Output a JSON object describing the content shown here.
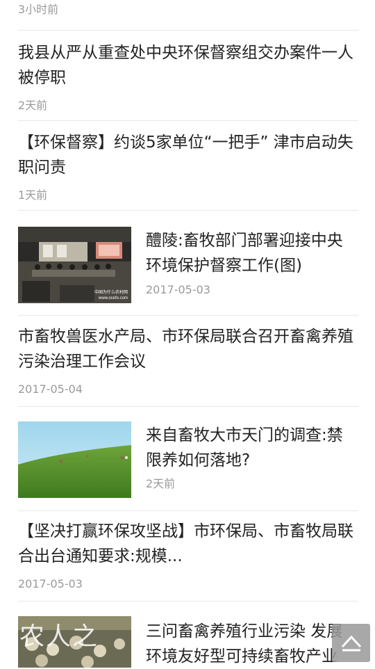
{
  "items": [
    {
      "meta": "3小时前"
    },
    {
      "title": "我县从严从重查处中央环保督察组交办案件一人被停职",
      "meta": "2天前"
    },
    {
      "title": "【环保督察】约谈5家单位“一把手” 津市启动失职问责",
      "meta": "1天前"
    },
    {
      "title": "醴陵:畜牧部门部署迎接中央环境保护督察工作(图)",
      "meta": "2017-05-03",
      "thumb_caption": "中国为什么农村网\nwww.ocefo.com"
    },
    {
      "title": "市畜牧兽医水产局、市环保局联合召开畜禽养殖污染治理工作会议",
      "meta": "2017-05-04"
    },
    {
      "title": "来自畜牧大市天门的调查:禁限养如何落地?",
      "meta": "2天前"
    },
    {
      "title": "【坚决打赢环保攻坚战】市环保局、市畜牧局联合出台通知要求:规模...",
      "meta": "2017-05-03"
    },
    {
      "title": "三问畜禽养殖行业污染 发展环境友好型可持续畜牧产业"
    }
  ],
  "watermark": "农人之",
  "icons": {
    "back_to_top": "chevron-up-icon"
  },
  "colors": {
    "meta": "#9a9a9a",
    "separator": "#e8e8e8",
    "title": "#222222"
  }
}
